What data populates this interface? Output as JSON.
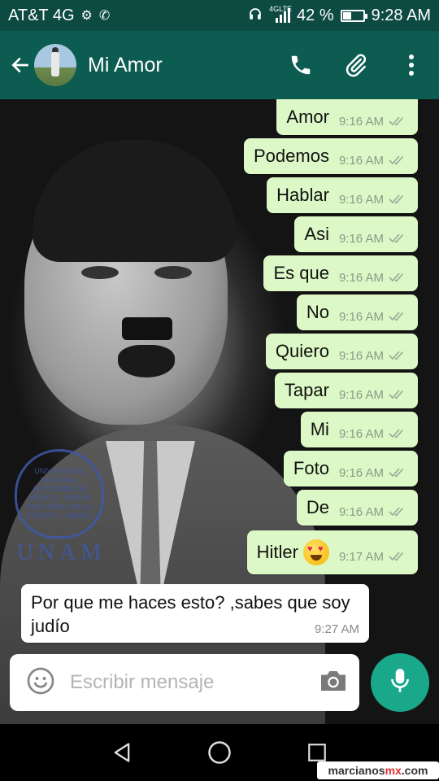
{
  "status_bar": {
    "carrier": "AT&T 4G",
    "network_tiny": "4GLTE",
    "battery": "42 %",
    "battery_level": 0.42,
    "time": "9:28 AM"
  },
  "header": {
    "contact_name": "Mi Amor",
    "icons": [
      "back-arrow-icon",
      "phone-icon",
      "paperclip-icon",
      "more-vert-icon"
    ]
  },
  "messages_out": [
    {
      "text": "Amor",
      "time": "9:16 AM"
    },
    {
      "text": "Podemos",
      "time": "9:16 AM"
    },
    {
      "text": "Hablar",
      "time": "9:16 AM"
    },
    {
      "text": "Asi",
      "time": "9:16 AM"
    },
    {
      "text": "Es que",
      "time": "9:16 AM"
    },
    {
      "text": "No",
      "time": "9:16 AM"
    },
    {
      "text": "Quiero",
      "time": "9:16 AM"
    },
    {
      "text": "Tapar",
      "time": "9:16 AM"
    },
    {
      "text": "Mi",
      "time": "9:16 AM"
    },
    {
      "text": "Foto",
      "time": "9:16 AM"
    },
    {
      "text": "De",
      "time": "9:16 AM"
    },
    {
      "text": "Hitler",
      "time": "9:17 AM",
      "emoji": "heart-eyes-emoji"
    }
  ],
  "message_in": {
    "text": "Por que me haces esto? ,sabes que soy judío",
    "time": "9:27 AM"
  },
  "wallpaper_logo": {
    "crest_text": "UNIVERSIDAD NACIONAL AUTÓNOMA DE MÉXICO · POR MI RAZA HABLARÁ EL ESPÍRITU · MEMES",
    "wordmark": "UNAM"
  },
  "composer": {
    "placeholder": "Escribir mensaje"
  },
  "watermark": {
    "site": "marcianos",
    "suffix": "mx",
    "tld": ".com"
  },
  "colors": {
    "header": "#0d5c52",
    "status_bar": "#0d4a42",
    "outgoing_bubble": "#dcf8c6",
    "incoming_bubble": "#ffffff",
    "mic_button": "#1aa88a",
    "unam_blue": "#3e59a8"
  }
}
